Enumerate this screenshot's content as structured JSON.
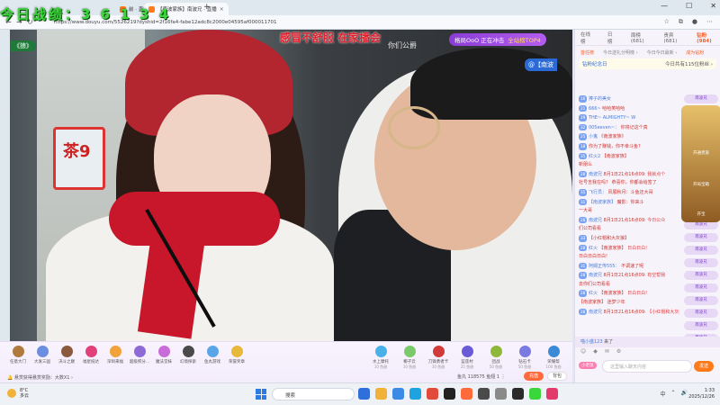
{
  "overlay": {
    "score": "今日战绩：3 6 1 3 4"
  },
  "browser": {
    "tabs": [
      {
        "label": "前 · 直播 · 斗鱼",
        "active": false
      },
      {
        "label": "【南波家族】南波兄 · 直播",
        "active": true
      }
    ],
    "new_tab": "+",
    "url": "https://www.douyu.com/5526219?dyshid=2f16fa4-fabe12adc8c2000e04595af000011701",
    "controls": {
      "minimize": "—",
      "maximize": "☐",
      "close": "✕"
    }
  },
  "video": {
    "top_banner": "感冒不舒服 在家播会",
    "left_tag": "《狼》",
    "rank_badge": {
      "text": "格局OoO 正在冲击",
      "highlight": "全站榜TOP4"
    },
    "subtitle": "你们公爵",
    "right_tag": "@【南波",
    "sign_text": "茶9"
  },
  "giftbar": {
    "gifts": [
      {
        "label": "任意大门",
        "sub": "",
        "color": "#b07a3d"
      },
      {
        "label": "大发三国",
        "sub": "",
        "color": "#6a8fe0"
      },
      {
        "label": "决斗之巅",
        "sub": "",
        "color": "#8b5a3c"
      },
      {
        "label": "福星抵达",
        "sub": "",
        "color": "#e2407a"
      },
      {
        "label": "深圳来福",
        "sub": "",
        "color": "#f2a23a"
      },
      {
        "label": "超级积分...",
        "sub": "",
        "color": "#8f6ad6"
      },
      {
        "label": "魔法堂妹",
        "sub": "",
        "color": "#c96bd8"
      },
      {
        "label": "幻境探索",
        "sub": "",
        "color": "#4a4a4a"
      },
      {
        "label": "鱼丸游戏",
        "sub": "",
        "color": "#5aa5e8"
      },
      {
        "label": "荣誉奖章",
        "sub": "",
        "color": "#e8b83a"
      }
    ],
    "gifts_right": [
      {
        "label": "水上摩托",
        "sub": "10 鱼翅",
        "color": "#4ab0e8"
      },
      {
        "label": "椰子云",
        "sub": "10 鱼翅",
        "color": "#7ac96b"
      },
      {
        "label": "刀锋勇者卡",
        "sub": "10 鱼翅",
        "color": "#d23a3a"
      },
      {
        "label": "蓝莲村",
        "sub": "25 鱼翅",
        "color": "#6a5ad6"
      },
      {
        "label": "团战",
        "sub": "50 鱼翅",
        "color": "#8fb83a"
      },
      {
        "label": "钻石卡",
        "sub": "50 鱼翅",
        "color": "#7a7ae0"
      },
      {
        "label": "荣耀帮",
        "sub": "100 鱼翅",
        "color": "#3a8ad6"
      }
    ],
    "marquee": "🔔 悬赏获得悬赏奖励：大数X1 ›",
    "fans": "鱼丸 118575  鱼翅 1  ⋮",
    "charge_label": "充值",
    "bag_label": "背包"
  },
  "side": {
    "tabs": [
      "在线榜",
      "日榜",
      "周榜(681)",
      "贵宾(681)",
      "钻粉(984)"
    ],
    "rank_tabs": [
      "首任榜",
      "今日送礼分明榜 ›",
      "今日今日最新 ›",
      "成为钻粉"
    ],
    "notice_left": "钻粉纪念日",
    "notice_right": "今日共有115位粉丝 ›",
    "messages": [
      {
        "lv": "16",
        "name": "捧子的美女",
        "text": "",
        "sys": ""
      },
      {
        "lv": "21",
        "name": "666~",
        "text": "哈哈笑哈哈",
        "sys": ""
      },
      {
        "lv": "19",
        "name": "THE~ ALMIGHTY~ W",
        "text": "",
        "sys": ""
      },
      {
        "lv": "32",
        "name": "005eeven~：",
        "text": "你将记这个真",
        "sys": ""
      },
      {
        "lv": "25",
        "name": "小鬼",
        "text": "《南波家族》",
        "sys": ""
      },
      {
        "lv": "18",
        "name": "",
        "text": "你为了赚钱，你不幸斗鱼?",
        "sys": ""
      },
      {
        "lv": "35",
        "name": "红火2",
        "text": "【南波家族】",
        "sys": ""
      },
      {
        "lv": "",
        "name": "",
        "text": "新朋么",
        "sys": ""
      },
      {
        "lv": "28",
        "name": "南波兄",
        "text": "8月1日21点16点09:",
        "sys": "我就点个"
      },
      {
        "lv": "",
        "name": "",
        "text": "社号吉我在吗？ 恭喜你，你都会给签了",
        "sys": ""
      },
      {
        "lv": "35",
        "name": "飞行员：",
        "text": "风展秋月：斗鱼还大哥",
        "sys": ""
      },
      {
        "lv": "31",
        "name": "【南波家族】",
        "text": "魔影：你来斗",
        "sys": ""
      },
      {
        "lv": "",
        "name": "",
        "text": "一大哥",
        "sys": ""
      },
      {
        "lv": "28",
        "name": "南波兄",
        "text": "8月1日21点16点09:",
        "sys": "今日公众"
      },
      {
        "lv": "",
        "name": "",
        "text": "们公司看看",
        "sys": ""
      },
      {
        "lv": "33",
        "name": "",
        "text": "【小红帽和大灰狼】",
        "sys": ""
      },
      {
        "lv": "28",
        "name": "红火",
        "text": "【南波家族】",
        "sys": "日白日白!"
      },
      {
        "lv": "",
        "name": "",
        "text": "日白日白日白!",
        "sys": ""
      },
      {
        "lv": "31",
        "name": "阿姆正传555：",
        "text": "不调速了呢",
        "sys": ""
      },
      {
        "lv": "28",
        "name": "南波兄",
        "text": "8月1日21点16点09:",
        "sys": "有空帮我"
      },
      {
        "lv": "",
        "name": "",
        "text": "去你们公司看看",
        "sys": ""
      },
      {
        "lv": "28",
        "name": "红火",
        "text": "【南波家族】",
        "sys": "日白日白!"
      },
      {
        "lv": "",
        "name": "",
        "text": "【南波家族】 迷梦少年",
        "sys": ""
      },
      {
        "lv": "28",
        "name": "南波兄",
        "text": "8月1日21点16点09:",
        "sys": "【小红帽和大灰狼】"
      }
    ],
    "right_badges": [
      "南波兄",
      "南波兄",
      "南波兄",
      "南波兄",
      "南波兄",
      "南波兄",
      "南波兄",
      "南波兄",
      "南波兄",
      "南波兄",
      "南波兄",
      "南波兄"
    ],
    "promo_labels": [
      "开通贵族",
      "开局宝箱",
      "开宝"
    ],
    "welcome": {
      "name": "喵小盛123",
      "text": "来了"
    },
    "input_placeholder": "这里输入聊天内容",
    "noble_tag": "小老鼠",
    "send_label": "发送"
  },
  "taskbar": {
    "weather_temp": "8°C",
    "weather_desc": "多云",
    "search_label": "搜索",
    "tray": [
      "中",
      "⌃",
      "🔊"
    ],
    "time": "1:33",
    "date": "2025/12/26",
    "apps": [
      "#2f6fdc",
      "#f2b23a",
      "#3b8ae6",
      "#1fa3e0",
      "#e24a3a",
      "#222222",
      "#ff6a3d",
      "#4a4a4a",
      "#8a8a8a",
      "#2a2a2a",
      "#3bd63b",
      "#e23a6a"
    ]
  }
}
